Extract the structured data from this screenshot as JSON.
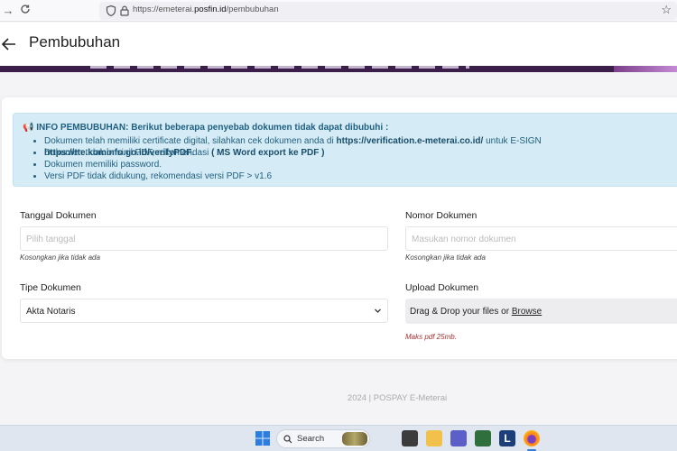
{
  "browser": {
    "url_prefix": "https://emeterai.",
    "url_domain": "posfin.id",
    "url_path": "/pembubuhan"
  },
  "header": {
    "title": "Pembubuhan"
  },
  "info": {
    "heading": "INFO PEMBUBUHAN: Berikut beberapa penyebab dokumen tidak dapat dibubuhi :",
    "item1_a": "Dokumen telah memiliki certificate digital, silahkan cek dokumen anda di ",
    "item1_link1": "https://verification.e-meterai.co.id/",
    "item1_b": " untuk E-SIGN ",
    "item1_link2": "https://tte.kominfo.go.id/verifyPDF",
    "item1_c": ".",
    "item2_a": "Dokumen tidak orisinil PDF, rekomendasi ",
    "item2_b": "( MS Word export ke PDF )",
    "item3": "Dokumen memiliki password.",
    "item4": "Versi PDF tidak didukung, rekomendasi versi PDF > v1.6"
  },
  "form": {
    "tanggal_label": "Tanggal Dokumen",
    "tanggal_placeholder": "Pilih tanggal",
    "tanggal_hint": "Kosongkan jika tidak ada",
    "nomor_label": "Nomor Dokumen",
    "nomor_placeholder": "Masukan nomor dokumen",
    "nomor_hint": "Kosongkan jika tidak ada",
    "tipe_label": "Tipe Dokumen",
    "tipe_value": "Akta Notaris",
    "upload_label": "Upload Dokumen",
    "upload_text": "Drag & Drop your files or ",
    "upload_browse": "Browse",
    "upload_hint": "Maks pdf 25mb."
  },
  "footer": {
    "text": "2024 | POSPAY E-Meterai"
  },
  "taskbar": {
    "search_label": "Search"
  },
  "colors": {
    "info_bg": "#d5ebf5",
    "info_text": "#1f5f80",
    "banner": "#3b1f4a",
    "hint_red": "#a43030"
  }
}
